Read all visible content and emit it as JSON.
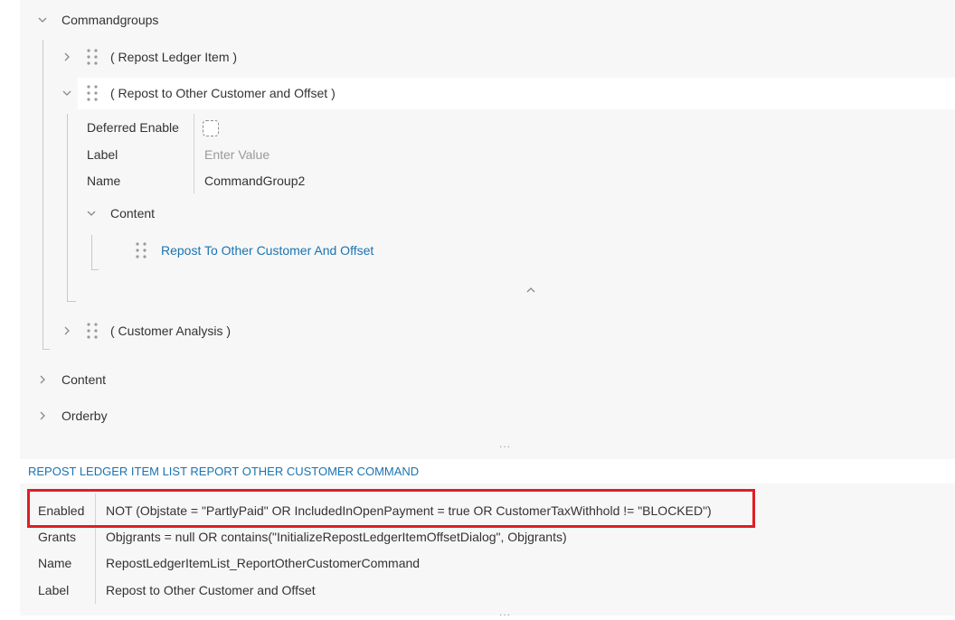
{
  "tree": {
    "commandgroups": {
      "label": "Commandgroups"
    },
    "groups": [
      {
        "label": "( Repost Ledger Item )"
      },
      {
        "label": "( Repost to Other Customer and Offset )"
      },
      {
        "label": "( Customer Analysis )"
      }
    ],
    "expanded_group": {
      "properties": [
        {
          "key": "Deferred Enable",
          "value": ""
        },
        {
          "key": "Label",
          "value": "",
          "placeholder": "Enter Value"
        },
        {
          "key": "Name",
          "value": "CommandGroup2"
        }
      ],
      "content": {
        "label": "Content",
        "items": [
          {
            "label": "Repost To Other Customer And Offset"
          }
        ]
      }
    },
    "content": {
      "label": "Content"
    },
    "orderby": {
      "label": "Orderby"
    },
    "more_glyph": "..."
  },
  "command_section": {
    "title": "REPOST LEDGER ITEM LIST REPORT OTHER CUSTOMER COMMAND",
    "properties": [
      {
        "key": "Enabled",
        "value": "NOT (Objstate = \"PartlyPaid\" OR IncludedInOpenPayment = true OR CustomerTaxWithhold != \"BLOCKED\")"
      },
      {
        "key": "Grants",
        "value": "Objgrants = null OR contains(\"InitializeRepostLedgerItemOffsetDialog\", Objgrants)"
      },
      {
        "key": "Name",
        "value": "RepostLedgerItemList_ReportOtherCustomerCommand"
      },
      {
        "key": "Label",
        "value": "Repost to Other Customer and Offset"
      }
    ],
    "more_glyph": "..."
  },
  "colors": {
    "accent": "#1a73b0",
    "highlight": "#e01e26",
    "panel": "#f7f7f7"
  },
  "icons": {
    "expand": "chevron-right-icon",
    "collapse": "chevron-down-icon",
    "drag": "drag-handle-icon",
    "collapse_up": "chevron-up-icon"
  }
}
